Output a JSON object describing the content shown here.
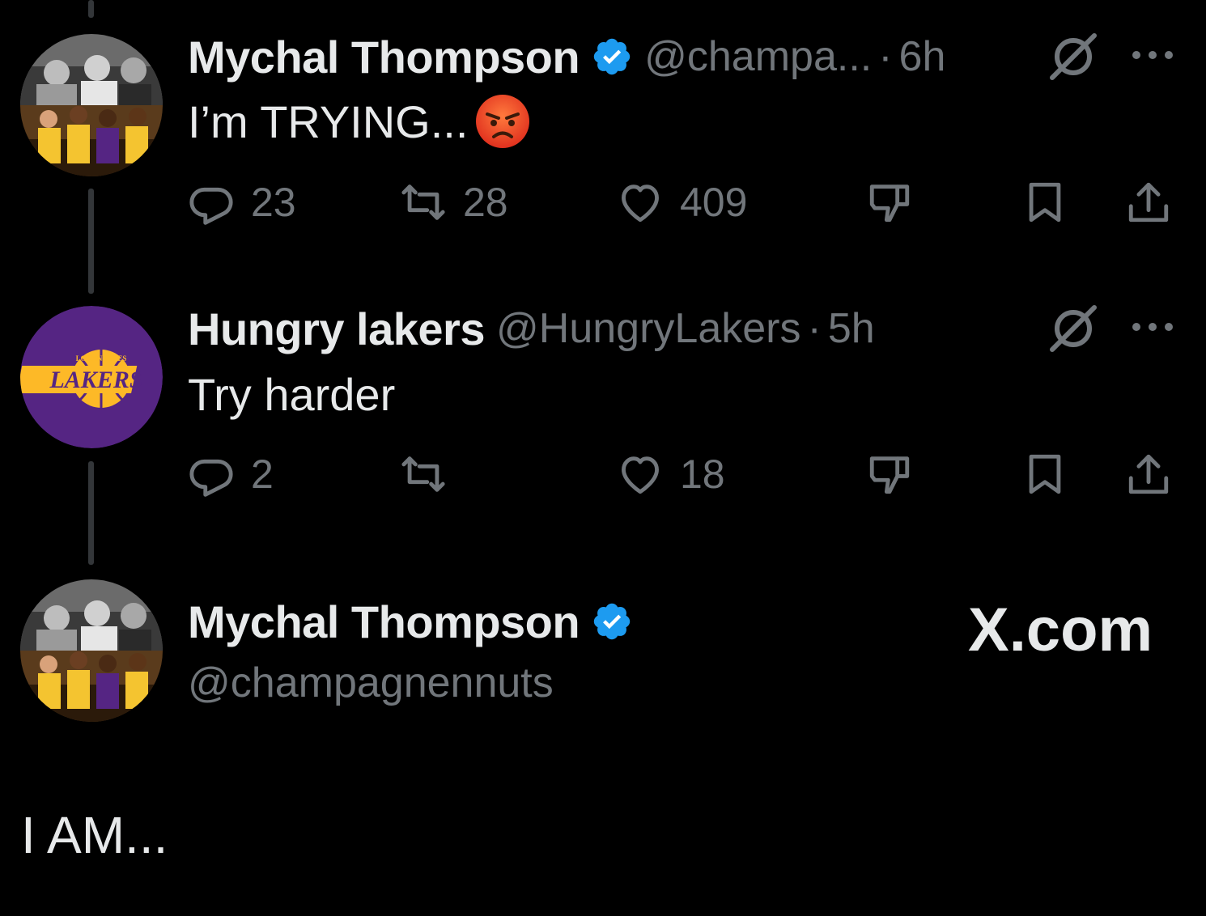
{
  "tweets": [
    {
      "author_name": "Mychal Thompson",
      "verified": true,
      "handle": "@champa...",
      "separator": "·",
      "time": "6h",
      "text": "I’m TRYING...",
      "emoji": "angry-face",
      "replies": "23",
      "reposts": "28",
      "likes": "409"
    },
    {
      "author_name": "Hungry lakers",
      "verified": false,
      "handle": "@HungryLakers",
      "separator": "·",
      "time": "5h",
      "text": "Try harder",
      "replies": "2",
      "reposts": "",
      "likes": "18"
    }
  ],
  "profile_card": {
    "name": "Mychal Thompson",
    "verified": true,
    "handle": "@champagnennuts"
  },
  "watermark": "X.com",
  "caption": "I AM...",
  "colors": {
    "background": "#000000",
    "text_primary": "#e7e9ea",
    "text_secondary": "#71767b",
    "verified_blue": "#1d9bf0",
    "lakers_purple": "#552583",
    "lakers_gold": "#fdb927"
  },
  "icons": [
    "reply-icon",
    "repost-icon",
    "like-icon",
    "dislike-icon",
    "bookmark-icon",
    "share-icon",
    "grok-icon",
    "more-icon",
    "verified-badge-icon"
  ]
}
